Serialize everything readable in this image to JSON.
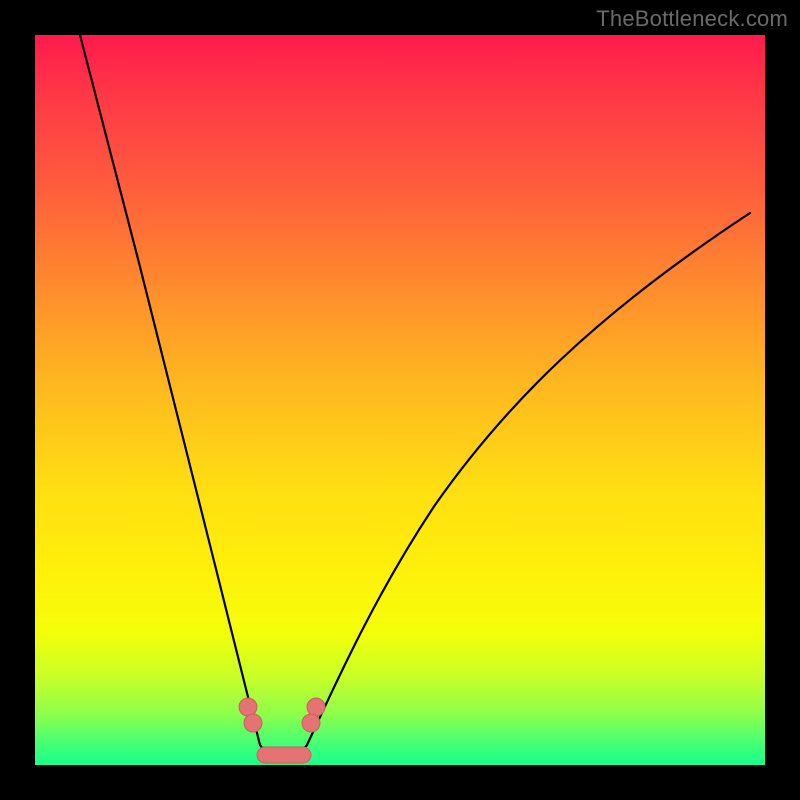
{
  "watermark": "TheBottleneck.com",
  "colors": {
    "frame": "#000000",
    "gradient_top": "#ff1a4d",
    "gradient_bottom": "#17ff8d",
    "curve": "#000000",
    "beads": "#e57373"
  },
  "chart_data": {
    "type": "line",
    "title": "",
    "xlabel": "",
    "ylabel": "",
    "xlim": [
      0,
      100
    ],
    "ylim": [
      0,
      100
    ],
    "grid": false,
    "legend": false,
    "series": [
      {
        "name": "left-curve",
        "x": [
          6,
          10,
          14,
          18,
          22,
          24,
          26,
          28,
          29.5,
          31
        ],
        "values": [
          100,
          82,
          64,
          47,
          30,
          22,
          15,
          9,
          5,
          2
        ]
      },
      {
        "name": "right-curve",
        "x": [
          37,
          39,
          41,
          44,
          48,
          54,
          62,
          72,
          84,
          98
        ],
        "values": [
          2,
          5,
          9,
          15,
          23,
          33,
          45,
          56,
          66,
          75.5
        ]
      },
      {
        "name": "bottom-flat",
        "x": [
          31,
          32,
          33,
          34,
          35,
          36,
          37
        ],
        "values": [
          2,
          1.4,
          1.1,
          1,
          1.1,
          1.4,
          2
        ]
      }
    ],
    "annotations": [
      {
        "name": "bead-cluster-left",
        "x": 29.5,
        "y": 5
      },
      {
        "name": "bead-cluster-right",
        "x": 39,
        "y": 5
      },
      {
        "name": "bead-bar-bottom",
        "x_range": [
          31,
          37
        ],
        "y": 1.2
      }
    ],
    "note": "Axes carry no visible tick labels; x/y normalized 0–100 from plot-area pixels."
  }
}
